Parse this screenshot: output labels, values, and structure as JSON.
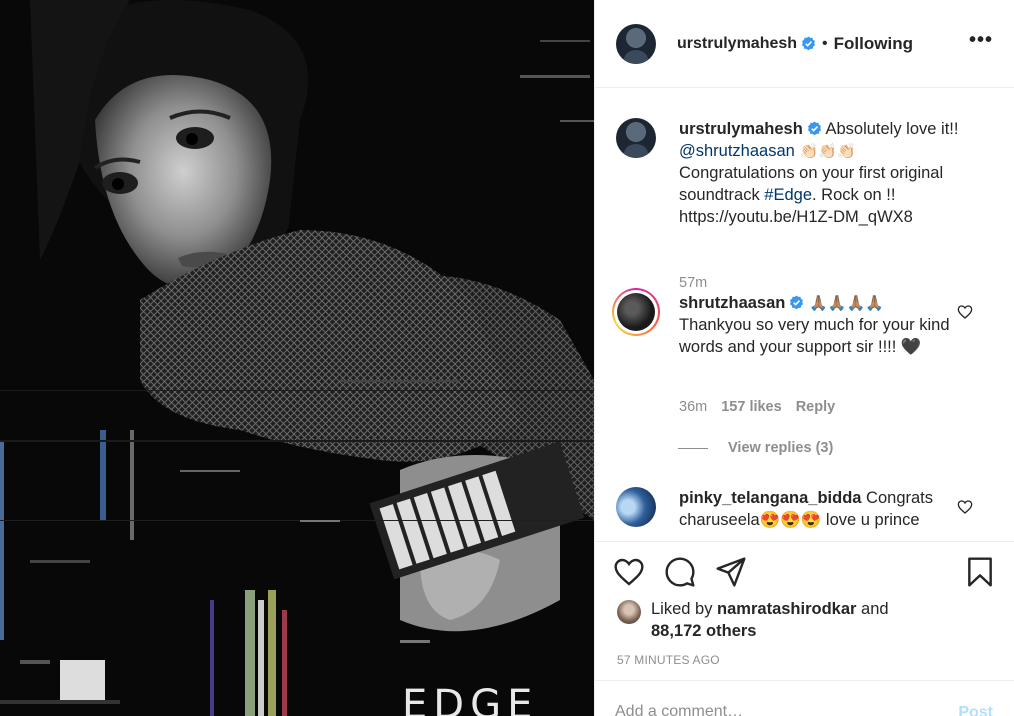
{
  "post_image": {
    "overlay_text": "EDGE"
  },
  "header": {
    "username": "urstrulymahesh",
    "separator": "•",
    "follow_status": "Following",
    "more_label": "•••"
  },
  "caption": {
    "username": "urstrulymahesh",
    "text_1": " Absolutely love it!!",
    "mention": "@shrutzhaasan",
    "emojis": " 👏🏻👏🏻👏🏻",
    "text_2": "Congratulations on your first original soundtrack ",
    "hashtag": "#Edge",
    "text_3": ". Rock on !!",
    "url": "https://youtu.be/H1Z-DM_qWX8",
    "time": "57m"
  },
  "comments": [
    {
      "username": "shrutzhaasan",
      "emojis": " 🙏🏽🙏🏽🙏🏽🙏🏽",
      "text": "Thankyou so very much for your kind words and your support sir !!!! 🖤",
      "time": "36m",
      "likes": "157 likes",
      "reply_label": "Reply",
      "view_replies": "View replies (3)"
    },
    {
      "username": "pinky_telangana_bidda",
      "text": " Congrats charuseela😍😍😍 love u prince"
    }
  ],
  "likes": {
    "prefix": "Liked by ",
    "user": "namratashirodkar",
    "suffix": " and",
    "others": "88,172 others"
  },
  "timestamp": "57 MINUTES AGO",
  "add_comment": {
    "placeholder": "Add a comment…",
    "post_label": "Post"
  },
  "colors": {
    "verified": "#3897f0",
    "link": "#00376b",
    "muted": "#8e8e8e",
    "post_disabled": "#b2dffc"
  },
  "icons": [
    "verified-badge-icon",
    "more-options-icon",
    "heart-icon",
    "comment-icon",
    "share-icon",
    "bookmark-icon"
  ]
}
